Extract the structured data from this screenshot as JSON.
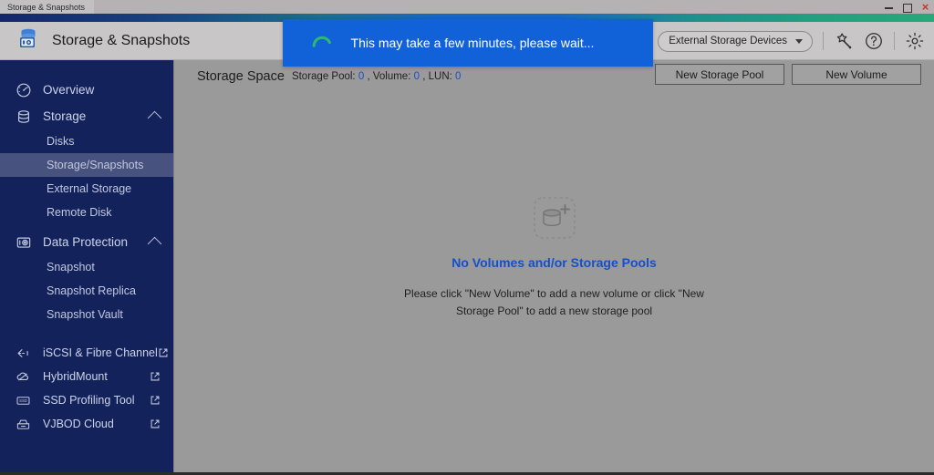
{
  "window": {
    "tab_title": "Storage & Snapshots",
    "controls": {
      "minimize": "minimize-window",
      "maximize": "maximize-window",
      "close": "×"
    }
  },
  "header": {
    "app_title": "Storage & Snapshots",
    "logo_icon": "storage-nas-icon",
    "external_storage_selector": {
      "label": "External Storage Devices",
      "caret_icon": "chevron-down-icon"
    },
    "icons": [
      {
        "name": "smart-search-icon",
        "label": "Smart Search"
      },
      {
        "name": "help-icon",
        "label": "Help"
      },
      {
        "name": "gear-icon",
        "label": "Settings"
      }
    ]
  },
  "sidebar": {
    "groups": [
      {
        "icon": "gauge-icon",
        "label": "Overview",
        "expandable": false,
        "children": []
      },
      {
        "icon": "database-icon",
        "label": "Storage",
        "expandable": true,
        "expanded": true,
        "children": [
          {
            "label": "Disks",
            "selected": false
          },
          {
            "label": "Storage/Snapshots",
            "selected": true
          },
          {
            "label": "External Storage",
            "selected": false
          },
          {
            "label": "Remote Disk",
            "selected": false
          }
        ]
      },
      {
        "icon": "camera-snapshot-icon",
        "label": "Data Protection",
        "expandable": true,
        "expanded": true,
        "children": [
          {
            "label": "Snapshot",
            "selected": false
          },
          {
            "label": "Snapshot Replica",
            "selected": false
          },
          {
            "label": "Snapshot Vault",
            "selected": false
          }
        ]
      }
    ],
    "external_links": [
      {
        "icon": "iscsi-icon",
        "label": "iSCSI & Fibre Channel"
      },
      {
        "icon": "hybridmount-icon",
        "label": "HybridMount"
      },
      {
        "icon": "ssd-icon",
        "label": "SSD Profiling Tool"
      },
      {
        "icon": "vjbod-icon",
        "label": "VJBOD Cloud"
      }
    ]
  },
  "content": {
    "space_title": "Storage Space",
    "counts": {
      "storage_pool_label": "Storage Pool:",
      "storage_pool_value": "0",
      "sep1": ",",
      "volume_label": "Volume:",
      "volume_value": "0",
      "sep2": ",",
      "lun_label": "LUN:",
      "lun_value": "0"
    },
    "buttons": {
      "new_storage_pool": "New Storage Pool",
      "new_volume": "New Volume"
    },
    "empty_state": {
      "icon": "add-storage-pool-icon",
      "title": "No Volumes and/or Storage Pools",
      "description": "Please click \"New Volume\" to add a new volume or click \"New Storage Pool\" to add a new storage pool"
    }
  },
  "toast": {
    "message": "This may take a few minutes, please wait...",
    "spinner_icon": "loading-spinner-icon"
  },
  "colors": {
    "accent_blue": "#1161d8",
    "link_blue": "#1550c8",
    "sidebar_navy": "#14225c",
    "sidebar_selected": "#47537e",
    "content_gray": "#9a9a9a",
    "header_gray": "#c9c6c8",
    "spinner_green": "#27a87a"
  }
}
